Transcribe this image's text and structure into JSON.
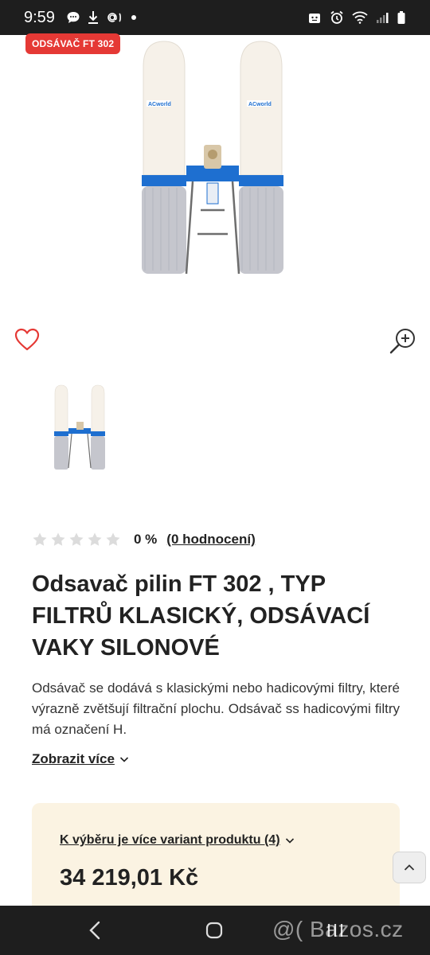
{
  "status_bar": {
    "time": "9:59",
    "left_icons": [
      "chat-bubble-icon",
      "download-icon",
      "email-at-icon",
      "dot-icon"
    ],
    "right_icons": [
      "android-icon",
      "alarm-icon",
      "wifi-icon",
      "signal-icon",
      "battery-icon"
    ]
  },
  "product": {
    "badge": "ODSÁVAČ FT 302",
    "rating_percent": "0 %",
    "rating_count": "(0 hodnocení)",
    "stars_filled": 0,
    "stars_total": 5,
    "title": "Odsavač pilin FT 302 , TYP FILTRŮ KLASICKÝ, ODSÁVACÍ VAKY SILONOVÉ",
    "description": "Odsávač se dodává s klasickými nebo hadicovými filtry, které výrazně zvětšují filtrační plochu. Odsávač ss hadicovými filtry má označení H.",
    "show_more": "Zobrazit více",
    "variants_link": "K výběru je více variant produktu (4)",
    "price": "34 219,01 Kč",
    "image_label": "ACworld"
  },
  "colors": {
    "badge": "#e53935",
    "variant_box": "#fbf3e2",
    "machine_blue": "#1565c0"
  },
  "nav_bar": {
    "watermark": "@( Bazos.cz"
  }
}
